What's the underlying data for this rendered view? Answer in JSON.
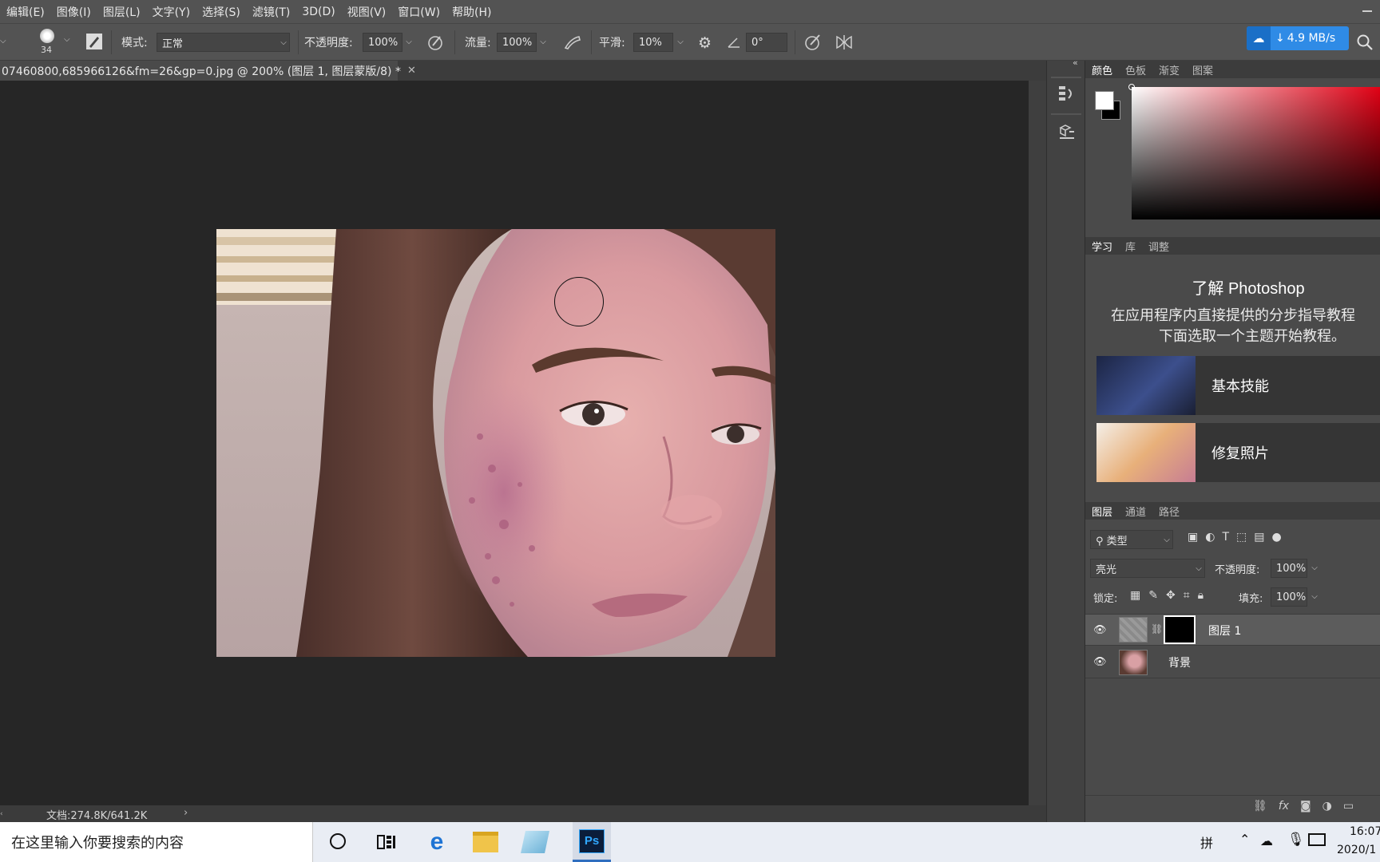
{
  "menu": [
    "编辑(E)",
    "图像(I)",
    "图层(L)",
    "文字(Y)",
    "选择(S)",
    "滤镜(T)",
    "3D(D)",
    "视图(V)",
    "窗口(W)",
    "帮助(H)"
  ],
  "options": {
    "brush_size": "34",
    "mode_label": "模式:",
    "mode_value": "正常",
    "opacity_label": "不透明度:",
    "opacity_value": "100%",
    "flow_label": "流量:",
    "flow_value": "100%",
    "smooth_label": "平滑:",
    "smooth_value": "10%",
    "angle_value": "0°",
    "net_speed": "4.9 MB/s"
  },
  "document": {
    "tab_title": "07460800,685966126&fm=26&gp=0.jpg @ 200% (图层 1, 图层蒙版/8) *",
    "status": "文档:274.8K/641.2K"
  },
  "color_panel": {
    "tabs": [
      "颜色",
      "色板",
      "渐变",
      "图案"
    ]
  },
  "learn_panel": {
    "tabs": [
      "学习",
      "库",
      "调整"
    ],
    "title": "了解 Photoshop",
    "desc_line1": "在应用程序内直接提供的分步指导教程",
    "desc_line2": "下面选取一个主题开始教程。",
    "items": [
      {
        "label": "基本技能"
      },
      {
        "label": "修复照片"
      }
    ]
  },
  "layers_panel": {
    "tabs": [
      "图层",
      "通道",
      "路径"
    ],
    "filter_label": "类型",
    "blend_mode": "亮光",
    "opacity_label": "不透明度:",
    "opacity_value": "100%",
    "lock_label": "锁定:",
    "fill_label": "填充:",
    "fill_value": "100%",
    "layers": [
      {
        "name": "图层 1"
      },
      {
        "name": "背景"
      }
    ]
  },
  "taskbar": {
    "search_placeholder": "在这里输入你要搜索的内容",
    "ime": "拼",
    "time": "16:07",
    "date": "2020/1"
  },
  "colors": {
    "accent_blue": "#2f8be6",
    "panel": "#4a4a4a",
    "canvas": "#262626"
  }
}
